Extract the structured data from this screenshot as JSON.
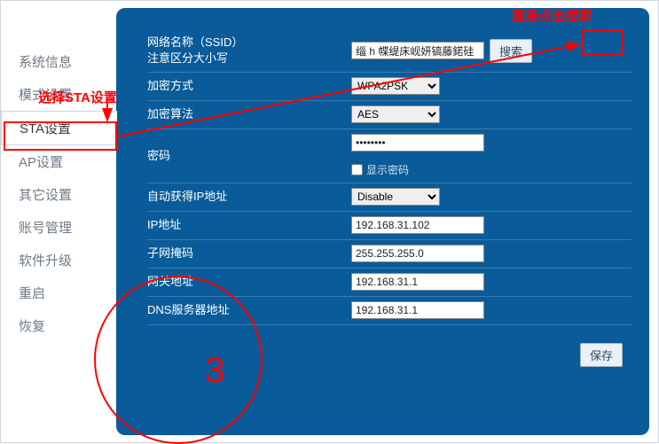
{
  "sidebar": {
    "items": [
      {
        "label": "系统信息"
      },
      {
        "label": "模式设置"
      },
      {
        "label": "STA设置"
      },
      {
        "label": "AP设置"
      },
      {
        "label": "其它设置"
      },
      {
        "label": "账号管理"
      },
      {
        "label": "软件升级"
      },
      {
        "label": "重启"
      },
      {
        "label": "恢复"
      }
    ],
    "active_index": 2
  },
  "form": {
    "ssid_label_line1": "网络名称（SSID）",
    "ssid_label_line2": "注意区分大小写",
    "ssid_value": "缁 h 幉缇床岘妍镐藤鍩硅",
    "search_btn": "搜索",
    "encrypt_method_label": "加密方式",
    "encrypt_method_value": "WPA2PSK",
    "encrypt_algo_label": "加密算法",
    "encrypt_algo_value": "AES",
    "password_label": "密码",
    "password_value": "••••••••",
    "show_password_label": "显示密码",
    "auto_ip_label": "自动获得IP地址",
    "auto_ip_value": "Disable",
    "ip_label": "IP地址",
    "ip_value": "192.168.31.102",
    "mask_label": "子网掩码",
    "mask_value": "255.255.255.0",
    "gateway_label": "网关地址",
    "gateway_value": "192.168.31.1",
    "dns_label": "DNS服务器地址",
    "dns_value": "192.168.31.1",
    "save_btn": "保存"
  },
  "annotations": {
    "search_hint": "直接点击搜索",
    "sta_hint": "选择STA设置",
    "step_number": "3"
  }
}
